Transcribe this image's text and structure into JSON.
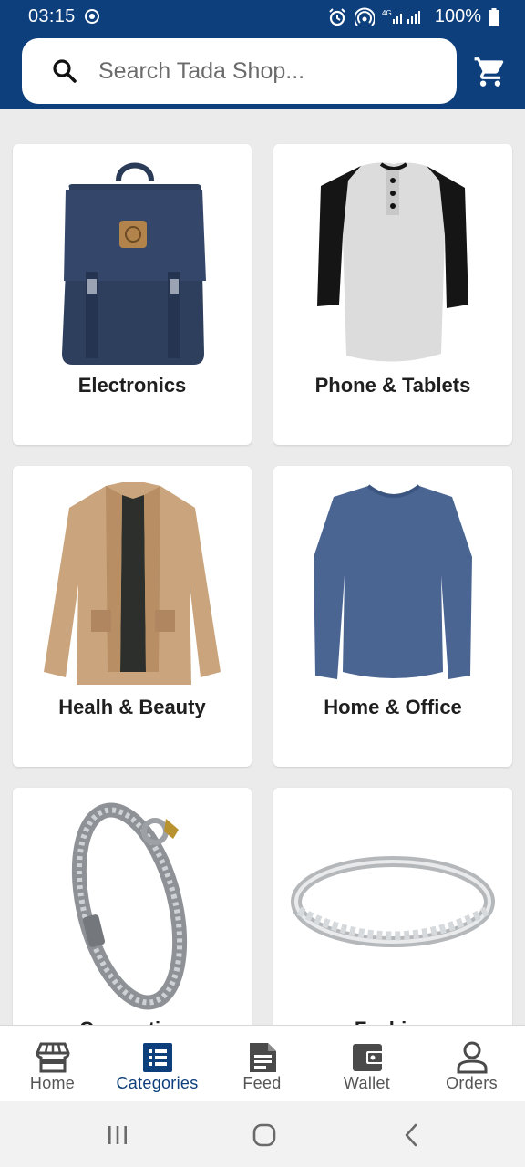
{
  "status_bar": {
    "time": "03:15",
    "battery": "100%",
    "network": "4G"
  },
  "search": {
    "placeholder": "Search Tada Shop..."
  },
  "categories": [
    {
      "label": "Electronics",
      "image": "backpack"
    },
    {
      "label": "Phone & Tablets",
      "image": "raglan-shirt"
    },
    {
      "label": "Healh & Beauty",
      "image": "jacket"
    },
    {
      "label": "Home & Office",
      "image": "long-sleeve-shirt"
    },
    {
      "label": "Computing",
      "image": "bracelet"
    },
    {
      "label": "Fashion",
      "image": "ring"
    }
  ],
  "bottom_nav": {
    "items": [
      {
        "label": "Home",
        "icon": "store-icon"
      },
      {
        "label": "Categories",
        "icon": "list-icon",
        "active": true
      },
      {
        "label": "Feed",
        "icon": "document-icon"
      },
      {
        "label": "Wallet",
        "icon": "wallet-icon"
      },
      {
        "label": "Orders",
        "icon": "person-icon"
      }
    ]
  },
  "colors": {
    "primary": "#0d3f7c",
    "background": "#ebebeb",
    "card": "#ffffff"
  }
}
